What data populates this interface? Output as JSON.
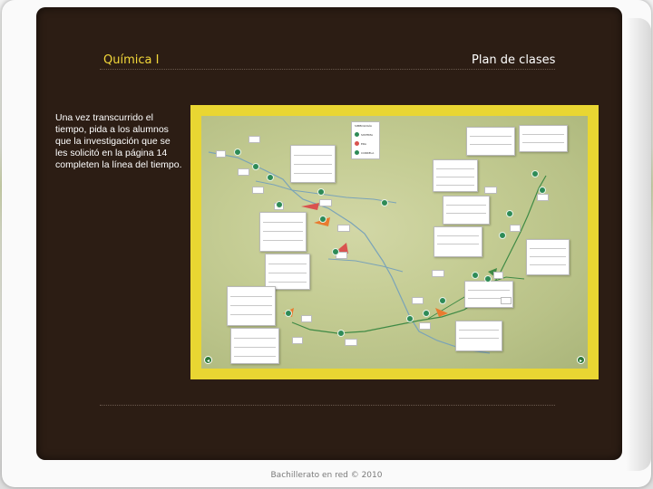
{
  "slide": {
    "subject_title": "Química I",
    "section_title": "Plan de clases",
    "instruction_text": "Una vez transcurrido el tiempo, pida a los alumnos que la investigación que se les solicitó en la página 14 completen la línea del tiempo.",
    "footer_text": "Bachillerato en red © 2010"
  },
  "embedded_screenshot": {
    "legend": {
      "title": "SIMBOLOGÍA",
      "items": [
        {
          "label": "SISTEMA",
          "color": "#2e8b57"
        },
        {
          "label": "ERA",
          "color": "#d9534f"
        },
        {
          "label": "CORRELA",
          "color": "#2e8b57"
        }
      ]
    },
    "nav_prev": "◂",
    "nav_next": "▸"
  },
  "colors": {
    "board": "#2c1d14",
    "accent_yellow": "#f4d93a",
    "screenshot_border": "#e9d632",
    "timeline_green": "#2e8b57"
  }
}
